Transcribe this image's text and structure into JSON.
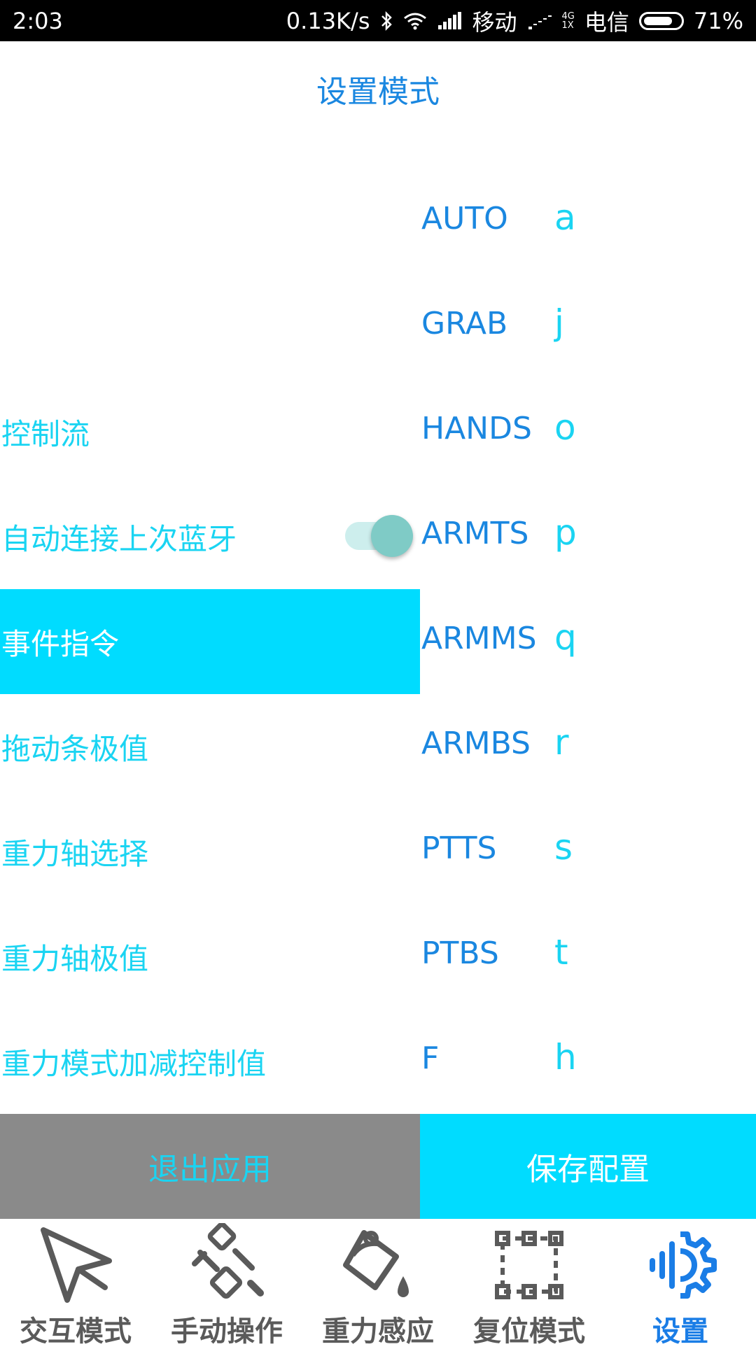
{
  "status_bar": {
    "time": "2:03",
    "speed": "0.13K/s",
    "carrier1": "移动",
    "net_top": "4G",
    "net_bottom": "1X",
    "carrier2": "电信",
    "battery": "71%"
  },
  "page_title": "设置模式",
  "menu": {
    "items": [
      {
        "label": "控制流"
      },
      {
        "label": "自动连接上次蓝牙"
      },
      {
        "label": "事件指令"
      },
      {
        "label": "拖动条极值"
      },
      {
        "label": "重力轴选择"
      },
      {
        "label": "重力轴极值"
      },
      {
        "label": "重力模式加减控制值"
      }
    ],
    "toggle_on": true
  },
  "commands": [
    {
      "key": "AUTO",
      "value": "a"
    },
    {
      "key": "GRAB",
      "value": "j"
    },
    {
      "key": "HANDS",
      "value": "o"
    },
    {
      "key": "ARMTS",
      "value": "p"
    },
    {
      "key": "ARMMS",
      "value": "q"
    },
    {
      "key": "ARMBS",
      "value": "r"
    },
    {
      "key": "PTTS",
      "value": "s"
    },
    {
      "key": "PTBS",
      "value": "t"
    },
    {
      "key": "F",
      "value": "h"
    }
  ],
  "actions": {
    "exit_label": "退出应用",
    "save_label": "保存配置"
  },
  "nav": {
    "tabs": [
      {
        "label": "交互模式",
        "icon": "send-arrow-icon"
      },
      {
        "label": "手动操作",
        "icon": "robot-arm-icon"
      },
      {
        "label": "重力感应",
        "icon": "paint-bucket-icon"
      },
      {
        "label": "复位模式",
        "icon": "dashed-frame-icon"
      },
      {
        "label": "设置",
        "icon": "settings-gear-icon"
      }
    ],
    "active_index": 4
  },
  "colors": {
    "title": "#1a87e0",
    "accent": "#00dcff",
    "cyan_text": "#1ad4f2",
    "nav_active": "#1a7de6",
    "nav_inactive": "#5a5a5a",
    "exit_bg": "#8a8a8a"
  }
}
